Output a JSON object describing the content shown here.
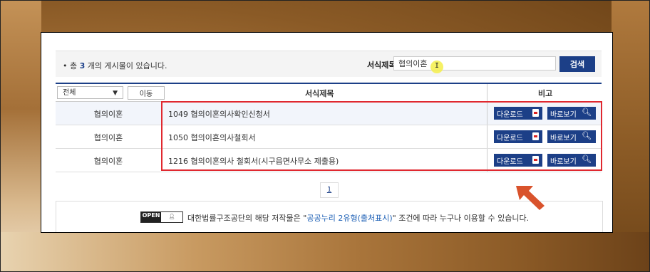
{
  "search_area": {
    "total_prefix": "총",
    "total_count": "3",
    "total_suffix": "개의 게시물이 있습니다.",
    "field_label": "서식제목",
    "query_value": "협의이혼",
    "search_button": "검색"
  },
  "table": {
    "filter_select": "전체",
    "move_button": "이동",
    "headers": {
      "title": "서식제목",
      "note": "비고"
    },
    "rows": [
      {
        "category": "협의이혼",
        "title": "1049 협의이혼의사확인신청서",
        "download": "다운로드",
        "view": "바로보기"
      },
      {
        "category": "협의이혼",
        "title": "1050 협의이혼의사철회서",
        "download": "다운로드",
        "view": "바로보기"
      },
      {
        "category": "협의이혼",
        "title": "1216 협의이혼의사 철회서(시구읍면사무소 제출용)",
        "download": "다운로드",
        "view": "바로보기"
      }
    ]
  },
  "pagination": {
    "current_page": "1"
  },
  "license": {
    "badge_open": "OPEN",
    "text_before": "대한법률구조공단의 해당 저작물은 \"",
    "link_text": "공공누리 2유형(출처표시)",
    "text_after": "\" 조건에 따라 누구나 이용할 수 있습니다."
  },
  "colors": {
    "primary_navy": "#1c3f87",
    "highlight_red": "#e0282f",
    "arrow_orange": "#d9532c",
    "cursor_yellow": "#f5ef4a"
  }
}
